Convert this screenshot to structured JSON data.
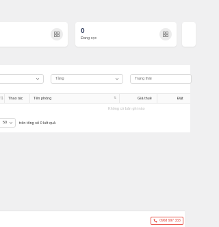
{
  "stats": {
    "card1": {
      "value": "",
      "label": ""
    },
    "card2": {
      "value": "0",
      "label": "Đang cọc"
    }
  },
  "filters": {
    "select1": "",
    "select2": "Tầng",
    "select3": "Trạng thái"
  },
  "table": {
    "columns": [
      "Thao tác",
      "Tên phòng",
      "Giá thuê",
      "Đặt"
    ],
    "empty_text": "Không có bản ghi nào"
  },
  "pagination": {
    "page_size": "50",
    "summary": "trên tổng số 0 kết quả"
  },
  "footer": {
    "phone": "0968 997 333"
  },
  "icons": {
    "stat": "grid-icon",
    "dropdown": "chevron-down-icon",
    "phone": "phone-icon"
  },
  "colors": {
    "background": "#f0f0f1",
    "card": "#ffffff",
    "accent": "#e03c31",
    "stat_value": "#2f3b5c"
  }
}
